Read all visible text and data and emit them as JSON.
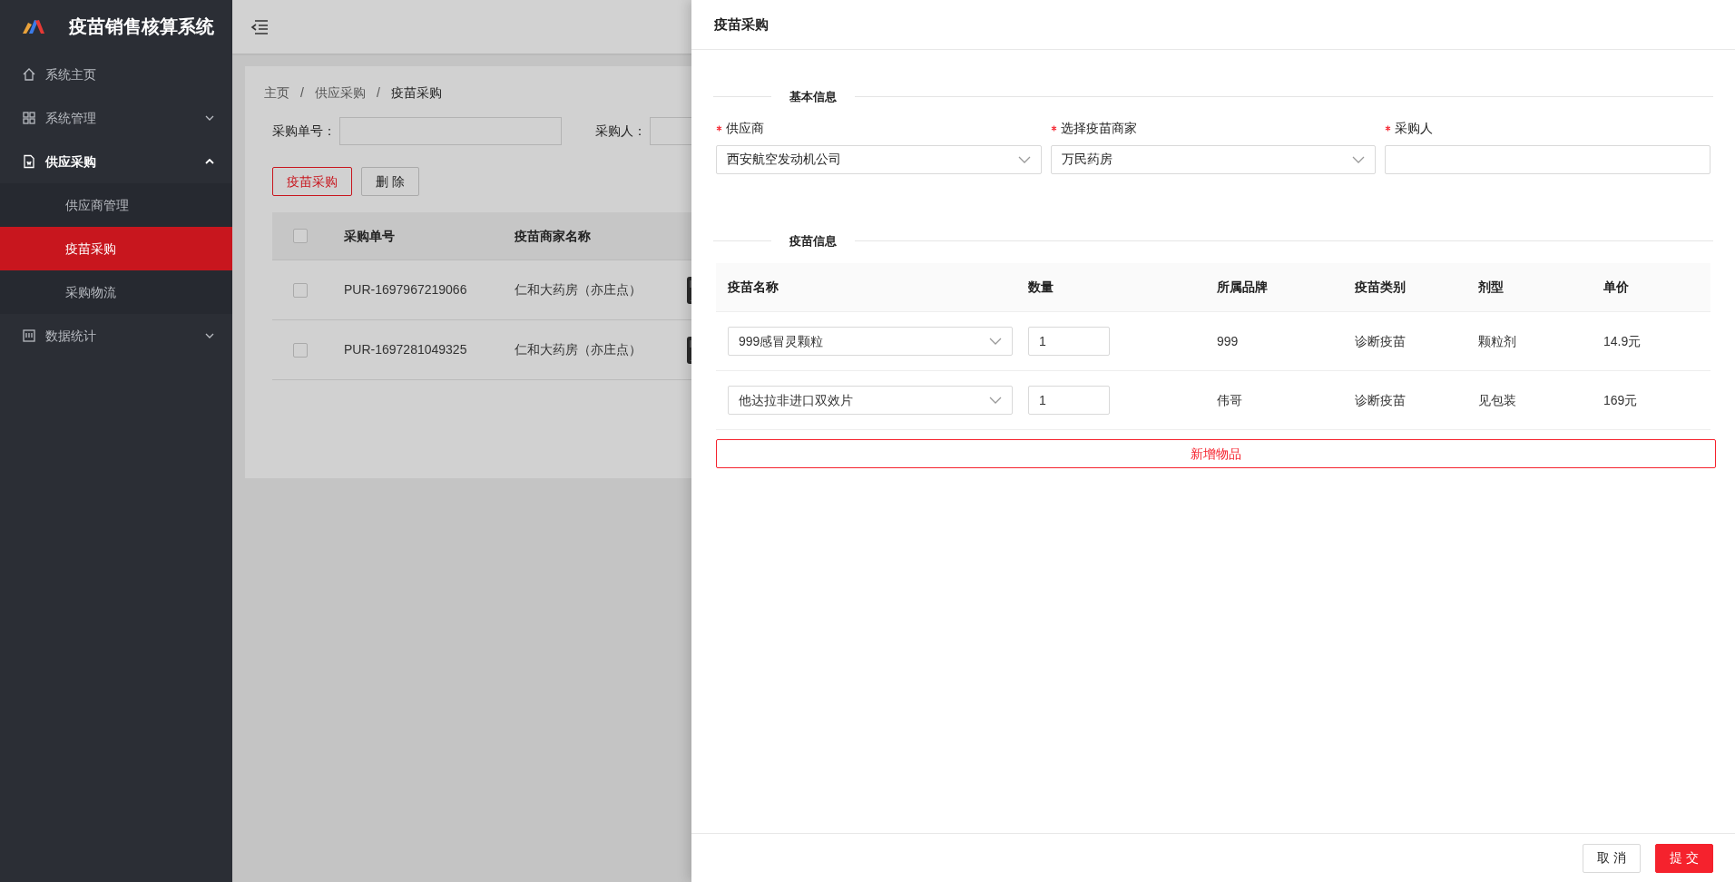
{
  "app": {
    "title": "疫苗销售核算系统"
  },
  "sidebar": {
    "items": [
      {
        "label": "系统主页",
        "kind": "link",
        "expanded": false
      },
      {
        "label": "系统管理",
        "kind": "group",
        "expanded": false
      },
      {
        "label": "供应采购",
        "kind": "group",
        "expanded": true,
        "children": [
          {
            "label": "供应商管理",
            "selected": false
          },
          {
            "label": "疫苗采购",
            "selected": true
          },
          {
            "label": "采购物流",
            "selected": false
          }
        ]
      },
      {
        "label": "数据统计",
        "kind": "group",
        "expanded": false
      }
    ]
  },
  "breadcrumb": {
    "separator": "/",
    "items": [
      "主页",
      "供应采购",
      "疫苗采购"
    ]
  },
  "filters": [
    {
      "label": "采购单号："
    },
    {
      "label": "采购人："
    }
  ],
  "toolbar": [
    {
      "label": "疫苗采购",
      "kind": "primary"
    },
    {
      "label": "删 除",
      "kind": "default"
    }
  ],
  "table": {
    "all_checked": false,
    "columns": [
      "采购单号",
      "疫苗商家名称"
    ],
    "rows": [
      {
        "checked": false,
        "cells": [
          "PUR-1697967219066",
          "仁和大药房（亦庄点）"
        ],
        "image": {
          "kind": "picture"
        }
      },
      {
        "checked": false,
        "cells": [
          "PUR-1697281049325",
          "仁和大药房（亦庄点）"
        ],
        "image": {
          "kind": "picture"
        }
      }
    ]
  },
  "drawer": {
    "title": "疫苗采购",
    "basic": {
      "heading": "基本信息",
      "fields": [
        {
          "label": "供应商",
          "required": true,
          "kind": "select",
          "value": "西安航空发动机公司"
        },
        {
          "label": "选择疫苗商家",
          "required": true,
          "kind": "select",
          "value": "万民药房"
        },
        {
          "label": "采购人",
          "required": true,
          "kind": "input"
        }
      ]
    },
    "items": {
      "heading": "疫苗信息",
      "columns": [
        "疫苗名称",
        "数量",
        "所属品牌",
        "疫苗类别",
        "剂型",
        "单价"
      ],
      "rows": [
        {
          "name": "999感冒灵颗粒",
          "quantity": "1",
          "brand": "999",
          "category": "诊断疫苗",
          "form": "颗粒剂",
          "price": "14.9元"
        },
        {
          "name": "他达拉非进口双效片",
          "quantity": "1",
          "brand": "伟哥",
          "category": "诊断疫苗",
          "form": "见包装",
          "price": "169元"
        }
      ],
      "add_button": "新增物品"
    },
    "footer": [
      {
        "label": "取 消",
        "kind": "default"
      },
      {
        "label": "提 交",
        "kind": "primary"
      }
    ]
  }
}
